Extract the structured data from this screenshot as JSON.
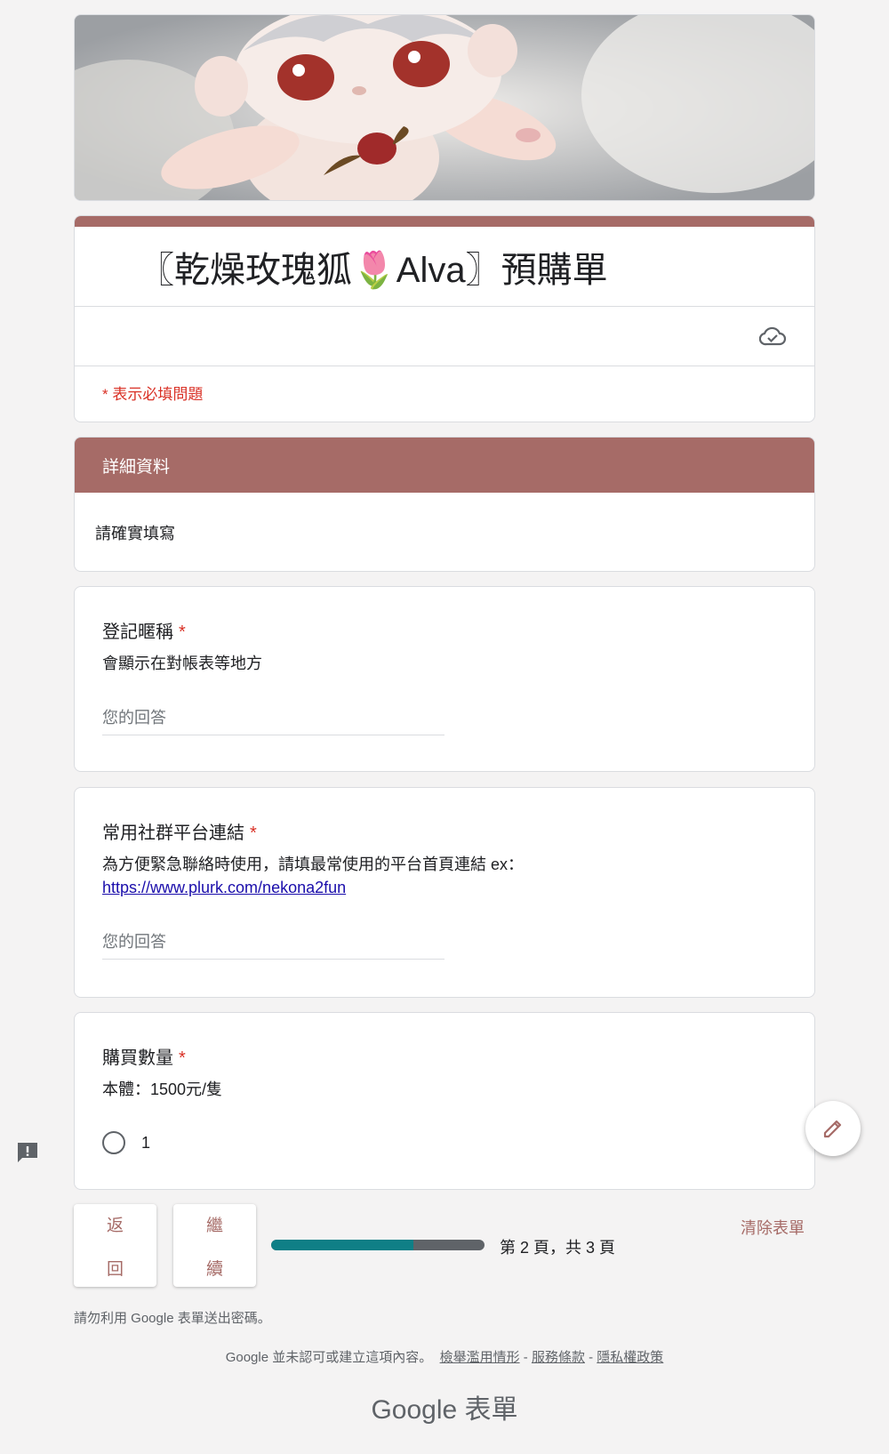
{
  "banner": {
    "image": "plush-doll-photo"
  },
  "form": {
    "title": "〖乾燥玫瑰狐🌷Alva〗預購單",
    "required_note": "* 表示必填問題",
    "cloud_icon": "cloud-check-icon"
  },
  "section": {
    "title": "詳細資料",
    "description": "請確實填寫"
  },
  "questions": [
    {
      "title": "登記暱稱",
      "star": "*",
      "description": "會顯示在對帳表等地方",
      "placeholder": "您的回答"
    },
    {
      "title": "常用社群平台連結",
      "star": "*",
      "description": "為方便緊急聯絡時使用，請填最常使用的平台首頁連結 ex：",
      "link": "https://www.plurk.com/nekona2fun",
      "placeholder": "您的回答"
    },
    {
      "title": "購買數量",
      "star": "*",
      "description": "本體：1500元/隻",
      "option": "1"
    }
  ],
  "nav": {
    "back_top": "返",
    "back_bottom": "回",
    "next_top": "繼",
    "next_bottom": "續",
    "page_text": "第 2 頁，共 3 頁",
    "progress": 0.667,
    "clear_form": "清除表單"
  },
  "footer": {
    "password_warning": "請勿利用 Google 表單送出密碼。",
    "disclaimer": "Google 並未認可或建立這項內容。",
    "report_link": "檢舉濫用情形",
    "sep1": " - ",
    "terms_link": "服務條款",
    "sep2": " - ",
    "privacy_link": "隱私權政策",
    "logo": "Google 表單"
  },
  "colors": {
    "theme": "#a66b67",
    "progress": "#0f7f86",
    "required": "#d93025",
    "link": "#1a0dab"
  }
}
